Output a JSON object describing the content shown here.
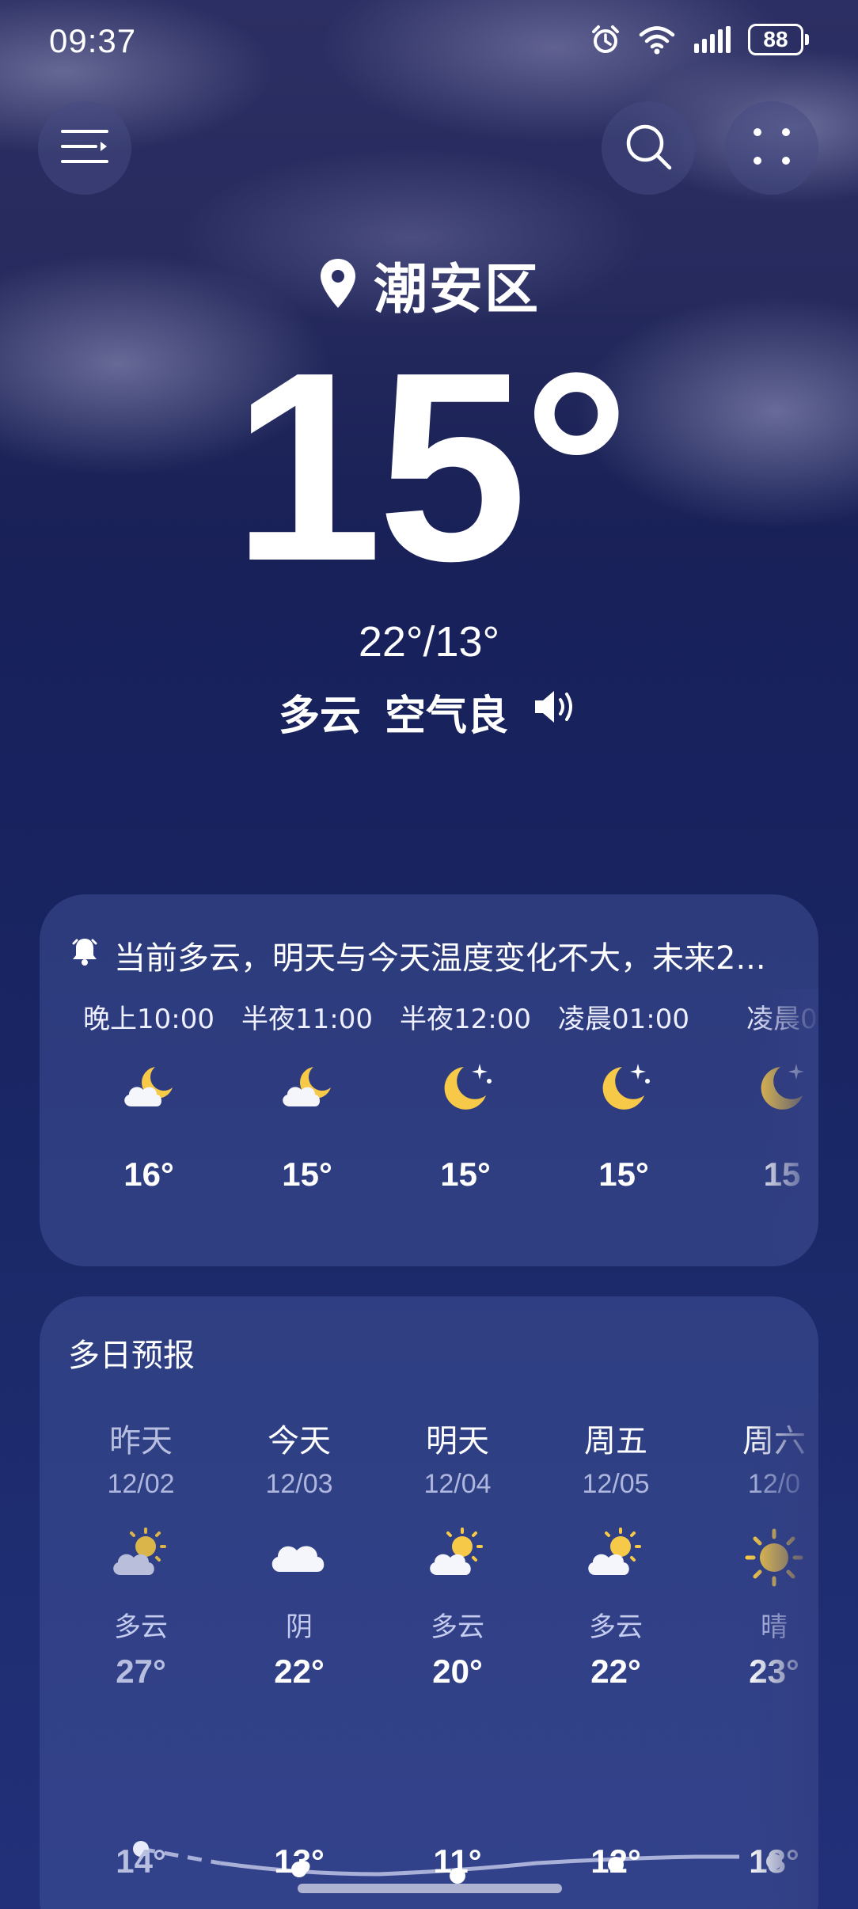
{
  "status_bar": {
    "time": "09:37",
    "battery": "88",
    "icons": [
      "alarm-icon",
      "wifi-icon",
      "signal-icon",
      "battery-icon"
    ]
  },
  "header": {
    "menu_icon": "menu-icon",
    "search_icon": "search-icon",
    "more_icon": "more-dots-icon"
  },
  "location": {
    "name": "潮安区",
    "icon": "location-pin-icon"
  },
  "current": {
    "temperature": "15°",
    "range": "22°/13°",
    "condition": "多云",
    "air_quality": "空气良",
    "speaker_icon": "speaker-icon"
  },
  "hourly": {
    "alert_icon": "bell-icon",
    "alert_text": "当前多云，明天与今天温度变化不大，未来2...",
    "hours": [
      {
        "time": "晚上10:00",
        "icon": "cloudy-night-icon",
        "temp": "16°"
      },
      {
        "time": "半夜11:00",
        "icon": "cloudy-night-icon",
        "temp": "15°"
      },
      {
        "time": "半夜12:00",
        "icon": "clear-night-icon",
        "temp": "15°"
      },
      {
        "time": "凌晨01:00",
        "icon": "clear-night-icon",
        "temp": "15°"
      },
      {
        "time": "凌晨0",
        "icon": "clear-night-icon",
        "temp": "15"
      }
    ]
  },
  "daily": {
    "title": "多日预报",
    "days": [
      {
        "name": "昨天",
        "date": "12/02",
        "icon": "partly-cloudy-icon",
        "condition": "多云",
        "high": "27°",
        "low": "14°",
        "past": true
      },
      {
        "name": "今天",
        "date": "12/03",
        "icon": "overcast-icon",
        "condition": "阴",
        "high": "22°",
        "low": "13°",
        "past": false
      },
      {
        "name": "明天",
        "date": "12/04",
        "icon": "partly-cloudy-icon",
        "condition": "多云",
        "high": "20°",
        "low": "11°",
        "past": false
      },
      {
        "name": "周五",
        "date": "12/05",
        "icon": "partly-cloudy-icon",
        "condition": "多云",
        "high": "22°",
        "low": "12°",
        "past": false
      },
      {
        "name": "周六",
        "date": "12/0",
        "icon": "sunny-icon",
        "condition": "晴",
        "high": "23°",
        "low": "13°",
        "past": false
      }
    ]
  },
  "colors": {
    "accent_sun": "#f7c948",
    "card_bg": "#3a4890",
    "page_bg": "#18235f"
  }
}
